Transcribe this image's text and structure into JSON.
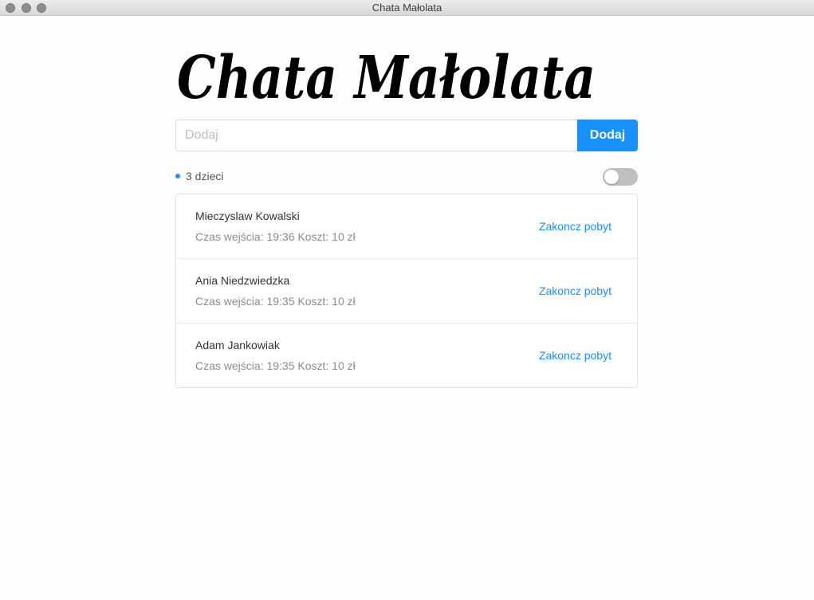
{
  "window": {
    "title": "Chata Małolata"
  },
  "logo": {
    "text": "Chata Małolata"
  },
  "add": {
    "placeholder": "Dodaj",
    "button_label": "Dodaj"
  },
  "summary": {
    "count_text": "3 dzieci",
    "toggle_on": false
  },
  "children": [
    {
      "name": "Mieczyslaw Kowalski",
      "meta": "Czas wejścia: 19:36 Koszt: 10 zł",
      "action": "Zakoncz pobyt"
    },
    {
      "name": "Ania Niedzwiedzka",
      "meta": "Czas wejścia: 19:35 Koszt: 10 zł",
      "action": "Zakoncz pobyt"
    },
    {
      "name": "Adam Jankowiak",
      "meta": "Czas wejścia: 19:35 Koszt: 10 zł",
      "action": "Zakoncz pobyt"
    }
  ],
  "colors": {
    "accent": "#1890ff",
    "toggle_off": "#bfbfbf"
  }
}
